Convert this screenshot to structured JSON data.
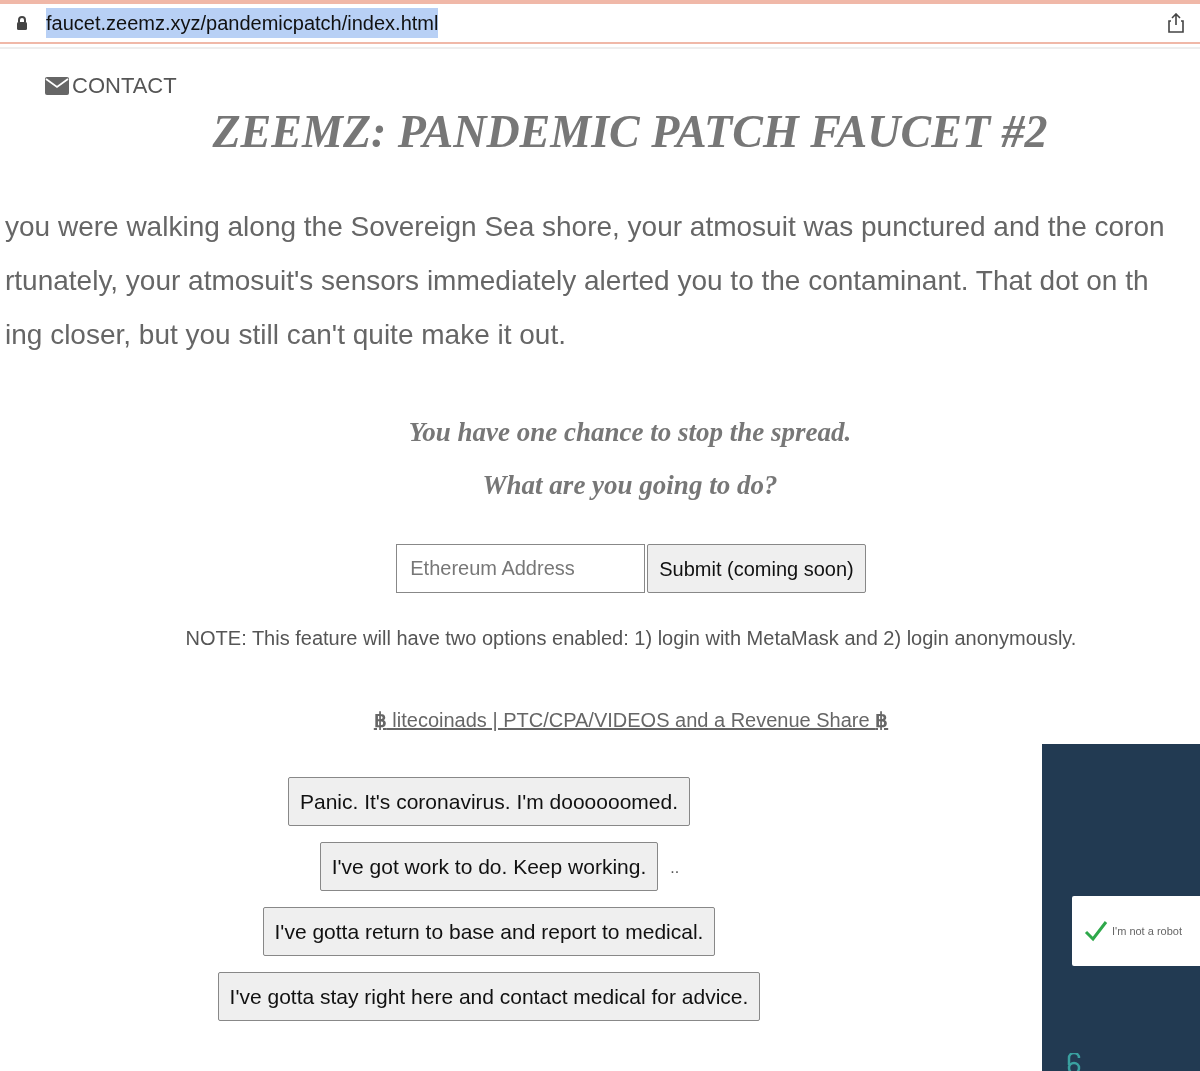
{
  "address_bar": {
    "url": "faucet.zeemz.xyz/pandemicpatch/index.html"
  },
  "nav": {
    "contact": "CONTACT"
  },
  "title": "ZEEMZ: PANDEMIC PATCH FAUCET #2",
  "story_lines": [
    "you were walking along the Sovereign Sea shore, your atmosuit was punctured and the coron",
    "rtunately, your atmosuit's sensors immediately alerted you to the contaminant. That dot on th",
    "ing closer, but you still can't quite make it out."
  ],
  "prompt_lines": [
    "You have one chance to stop the spread.",
    "What are you going to do?"
  ],
  "address_form": {
    "placeholder": "Ethereum Address",
    "submit": "Submit (coming soon)"
  },
  "note": "NOTE: This feature will have two options enabled: 1) login with MetaMask and 2) login anonymously.",
  "ad_link": {
    "left_symbol": "฿",
    "text": " litecoinads | PTC/CPA/VIDEOS and a Revenue Share ",
    "right_symbol": "฿"
  },
  "choices": [
    {
      "label": "Panic. It's coronavirus. I'm doooooomed."
    },
    {
      "label": "I've got work to do. Keep working.",
      "trailing": ".."
    },
    {
      "label": "I've gotta return to base and report to medical."
    },
    {
      "label": "I've gotta stay right here and contact medical for advice."
    }
  ],
  "captcha_ad": {
    "label": "I'm not a robot",
    "checked": true
  }
}
